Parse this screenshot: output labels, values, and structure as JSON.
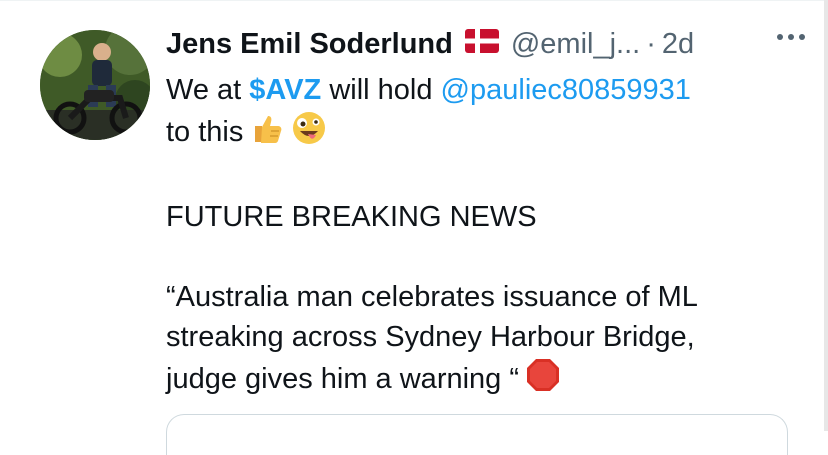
{
  "tweet": {
    "author_name": "Jens Emil Soderlund",
    "flag_icon": "denmark-flag-icon",
    "handle": "@emil_j...",
    "separator": "·",
    "time": "2d",
    "more_icon": "more-dots-icon",
    "text_line1_a": "We at ",
    "cashtag": "$AVZ",
    "text_line1_b": " will hold ",
    "mention": "@pauliec80859931",
    "text_line2": "to this",
    "emoji_1": "thumbs-up-icon",
    "emoji_2": "zany-face-icon",
    "headline": "FUTURE BREAKING NEWS",
    "quote_line1": "“Australia man celebrates issuance of ML",
    "quote_line2": "streaking across Sydney Harbour Bridge,",
    "quote_line3": "judge gives him a warning “",
    "emoji_3": "stop-sign-icon"
  }
}
